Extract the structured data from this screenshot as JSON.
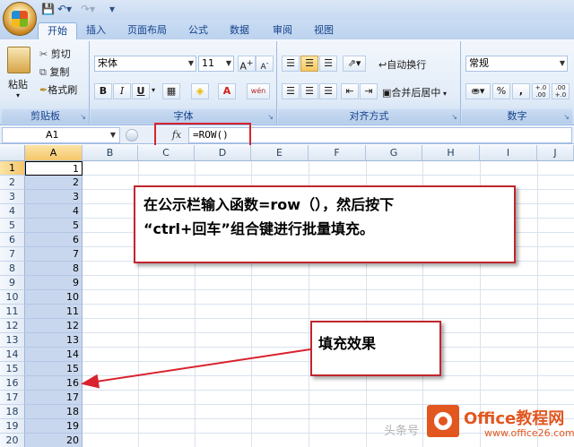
{
  "tabs": [
    "开始",
    "插入",
    "页面布局",
    "公式",
    "数据",
    "审阅",
    "视图"
  ],
  "clipboard": {
    "paste": "粘贴",
    "cut": "剪切",
    "copy": "复制",
    "format_painter": "格式刷",
    "label": "剪贴板"
  },
  "font": {
    "name": "宋体",
    "size": "11",
    "bold": "B",
    "italic": "I",
    "underline": "U",
    "label": "字体",
    "grow": "A",
    "shrink": "A",
    "color_glyph": "A",
    "phonetic": "wén"
  },
  "alignment": {
    "wrap": "自动换行",
    "merge": "合并后居中",
    "label": "对齐方式"
  },
  "number": {
    "format": "常规",
    "percent": "%",
    "comma": ",",
    "inc_decimal": "+.0 .00",
    "dec_decimal": ".00 +.0",
    "label": "数字"
  },
  "formula_bar": {
    "name_box": "A1",
    "fx": "fx",
    "formula": "=ROW()"
  },
  "columns": [
    "A",
    "B",
    "C",
    "D",
    "E",
    "F",
    "G",
    "H",
    "I",
    "J"
  ],
  "rows": [
    "1",
    "2",
    "3",
    "4",
    "5",
    "6",
    "7",
    "8",
    "9",
    "10",
    "11",
    "12",
    "13",
    "14",
    "15",
    "16",
    "17",
    "18",
    "19",
    "20"
  ],
  "cells_a": [
    "1",
    "2",
    "3",
    "4",
    "5",
    "6",
    "7",
    "8",
    "9",
    "10",
    "11",
    "12",
    "13",
    "14",
    "15",
    "16",
    "17",
    "18",
    "19",
    "20"
  ],
  "callout_main": {
    "line1": "在公示栏输入函数=row（），然后按下",
    "line2": "“ctrl+回车”组合键进行批量填充。"
  },
  "callout_fill": "填充效果",
  "watermark": {
    "prefix": "头条号",
    "brand": "Office教程网",
    "url": "www.office26.com"
  }
}
